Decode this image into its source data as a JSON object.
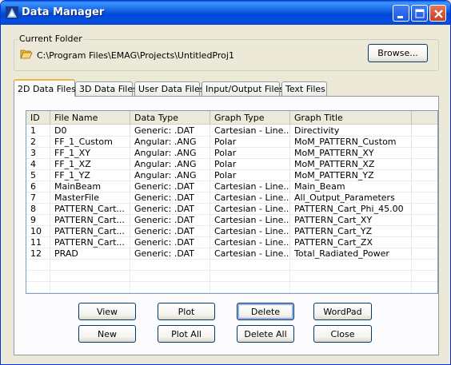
{
  "window": {
    "title": "Data Manager"
  },
  "current_folder": {
    "label": "Current Folder",
    "path": "C:\\Program Files\\EMAG\\Projects\\UntitledProj1",
    "browse_label": "Browse..."
  },
  "tabs": [
    {
      "label": "2D Data Files",
      "active": true
    },
    {
      "label": "3D Data Files",
      "active": false
    },
    {
      "label": "User Data Files",
      "active": false
    },
    {
      "label": "Input/Output Files",
      "active": false
    },
    {
      "label": "Text Files",
      "active": false
    }
  ],
  "table": {
    "columns": [
      "ID",
      "File Name",
      "Data Type",
      "Graph Type",
      "Graph Title"
    ],
    "rows": [
      [
        "1",
        "D0",
        "Generic: .DAT",
        "Cartesian - Line...",
        "Directivity"
      ],
      [
        "2",
        "FF_1_Custom",
        "Angular: .ANG",
        "Polar",
        "MoM_PATTERN_Custom"
      ],
      [
        "3",
        "FF_1_XY",
        "Angular: .ANG",
        "Polar",
        "MoM_PATTERN_XY"
      ],
      [
        "4",
        "FF_1_XZ",
        "Angular: .ANG",
        "Polar",
        "MoM_PATTERN_XZ"
      ],
      [
        "5",
        "FF_1_YZ",
        "Angular: .ANG",
        "Polar",
        "MoM_PATTERN_YZ"
      ],
      [
        "6",
        "MainBeam",
        "Generic: .DAT",
        "Cartesian - Line...",
        "Main_Beam"
      ],
      [
        "7",
        "MasterFile",
        "Generic: .DAT",
        "Cartesian - Line...",
        "All_Output_Parameters"
      ],
      [
        "8",
        "PATTERN_Cart...",
        "Generic: .DAT",
        "Cartesian - Line...",
        "PATTERN_Cart_Phi_45.00"
      ],
      [
        "9",
        "PATTERN_Cart...",
        "Generic: .DAT",
        "Cartesian - Line...",
        "PATTERN_Cart_XY"
      ],
      [
        "10",
        "PATTERN_Cart...",
        "Generic: .DAT",
        "Cartesian - Line...",
        "PATTERN_Cart_YZ"
      ],
      [
        "11",
        "PATTERN_Cart...",
        "Generic: .DAT",
        "Cartesian - Line...",
        "PATTERN_Cart_ZX"
      ],
      [
        "12",
        "PRAD",
        "Generic: .DAT",
        "Cartesian - Line...",
        "Total_Radiated_Power"
      ]
    ]
  },
  "buttons": {
    "view": "View",
    "plot": "Plot",
    "delete": "Delete",
    "wordpad": "WordPad",
    "new": "New",
    "plot_all": "Plot All",
    "delete_all": "Delete All",
    "close": "Close"
  },
  "icons": {
    "app": "app-icon",
    "minimize": "minimize-icon",
    "maximize": "maximize-icon",
    "close": "close-icon",
    "folder": "folder-open-icon"
  },
  "colors": {
    "titlebar": "#0a5fd8",
    "close_button": "#e0502a",
    "tab_highlight": "#f5b33f"
  }
}
